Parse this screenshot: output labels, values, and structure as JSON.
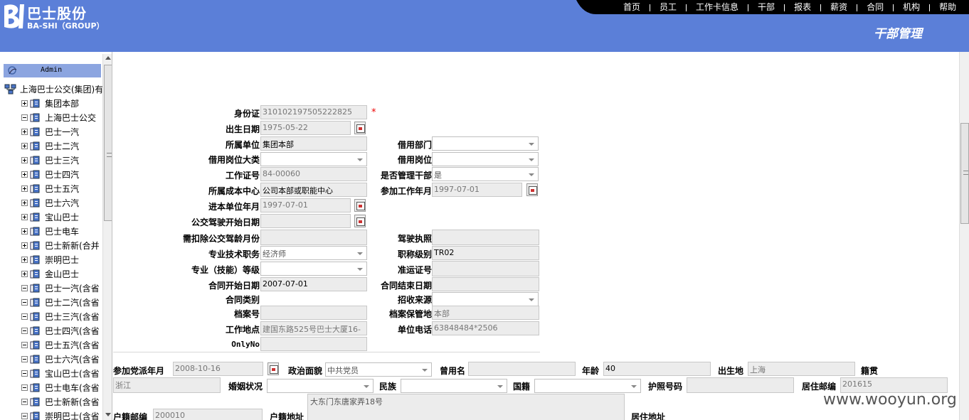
{
  "header": {
    "logo_cn": "巴士股份",
    "logo_en": "BA-SHI（GROUP）",
    "title": "干部管理",
    "nav": [
      "首页",
      "员工",
      "工作卡信息",
      "干部",
      "报表",
      "薪资",
      "合同",
      "机构",
      "帮助"
    ],
    "color": "#5b7fd8"
  },
  "sidebar": {
    "user": "Admin",
    "root": "上海巴士公交(集团)有",
    "items": [
      {
        "label": "集团本部",
        "expanded": false
      },
      {
        "label": "上海巴士公交",
        "expanded": true
      },
      {
        "label": "巴士一汽",
        "expanded": false
      },
      {
        "label": "巴士二汽",
        "expanded": false
      },
      {
        "label": "巴士三汽",
        "expanded": false
      },
      {
        "label": "巴士四汽",
        "expanded": false
      },
      {
        "label": "巴士五汽",
        "expanded": false
      },
      {
        "label": "巴士六汽",
        "expanded": false
      },
      {
        "label": "宝山巴士",
        "expanded": false
      },
      {
        "label": "巴士电车",
        "expanded": false
      },
      {
        "label": "巴士新新(合并",
        "expanded": false
      },
      {
        "label": "崇明巴士",
        "expanded": false
      },
      {
        "label": "金山巴士",
        "expanded": false
      },
      {
        "label": "巴士一汽(含省",
        "expanded": true
      },
      {
        "label": "巴士二汽(含省",
        "expanded": true
      },
      {
        "label": "巴士三汽(含省",
        "expanded": true
      },
      {
        "label": "巴士四汽(含省",
        "expanded": true
      },
      {
        "label": "巴士五汽(含省",
        "expanded": true
      },
      {
        "label": "巴士六汽(含省",
        "expanded": true
      },
      {
        "label": "宝山巴士(含省",
        "expanded": true
      },
      {
        "label": "巴士电车(含省",
        "expanded": true
      },
      {
        "label": "巴士新新(含省",
        "expanded": true
      },
      {
        "label": "崇明巴士(含省",
        "expanded": true
      }
    ]
  },
  "form": {
    "id_card": {
      "label": "身份证",
      "value": "310102197505222825"
    },
    "birth_date": {
      "label": "出生日期",
      "value": "1975-05-22"
    },
    "unit": {
      "label": "所属单位",
      "value": "集团本部"
    },
    "borrow_dept": {
      "label": "借用部门",
      "value": ""
    },
    "borrow_post_cat": {
      "label": "借用岗位大类",
      "value": ""
    },
    "borrow_post": {
      "label": "借用岗位",
      "value": ""
    },
    "work_no": {
      "label": "工作证号",
      "value": "84-00060"
    },
    "is_mgr": {
      "label": "是否管理干部",
      "value": "是"
    },
    "cost_center": {
      "label": "所属成本中心",
      "value": "公司本部或职能中心"
    },
    "work_start": {
      "label": "参加工作年月",
      "value": "1997-07-01"
    },
    "join_unit": {
      "label": "进本单位年月",
      "value": "1997-07-01"
    },
    "bus_drive_start": {
      "label": "公交驾驶开始日期",
      "value": ""
    },
    "deduct_months": {
      "label": "需扣除公交驾龄月份",
      "value": ""
    },
    "license": {
      "label": "驾驶执照",
      "value": ""
    },
    "tech_post": {
      "label": "专业技术职务",
      "value": "经济师"
    },
    "title_level": {
      "label": "职称级别",
      "value": "TR02"
    },
    "skill_level": {
      "label": "专业（技能）等级",
      "value": ""
    },
    "permit": {
      "label": "准运证号",
      "value": ""
    },
    "contract_start": {
      "label": "合同开始日期",
      "value": "2007-07-01"
    },
    "contract_end": {
      "label": "合同结束日期",
      "value": ""
    },
    "contract_type": {
      "label": "合同类别",
      "value": ""
    },
    "recruit_src": {
      "label": "招收来源",
      "value": ""
    },
    "archive_no": {
      "label": "档案号",
      "value": ""
    },
    "archive_loc": {
      "label": "档案保管地",
      "value": "本部"
    },
    "work_place": {
      "label": "工作地点",
      "value": "建国东路525号巴士大厦16-"
    },
    "unit_phone": {
      "label": "单位电话",
      "value": "63848484*2506"
    },
    "only_no": {
      "label": "OnlyNo",
      "value": ""
    }
  },
  "personal": {
    "party_date": {
      "label": "参加党派年月",
      "value": "2008-10-16"
    },
    "politics": {
      "label": "政治面貌",
      "value": "中共党员"
    },
    "former_name": {
      "label": "曾用名",
      "value": ""
    },
    "age": {
      "label": "年龄",
      "value": "40"
    },
    "birthplace": {
      "label": "出生地",
      "value": "上海"
    },
    "native": {
      "label": "籍贯",
      "value": "浙江"
    },
    "marital": {
      "label": "婚姻状况",
      "value": ""
    },
    "ethnic": {
      "label": "民族",
      "value": ""
    },
    "nationality": {
      "label": "国籍",
      "value": ""
    },
    "passport": {
      "label": "护照号码",
      "value": ""
    },
    "res_zip": {
      "label": "居住邮编",
      "value": "201615"
    },
    "hukou_zip": {
      "label": "户籍邮编",
      "value": "200010"
    },
    "hukou_addr": {
      "label": "户籍地址",
      "value": "大东门东唐家弄18号"
    },
    "res_addr": {
      "label": "居住地址",
      "value": ""
    }
  },
  "watermark": "www.wooyun.org"
}
